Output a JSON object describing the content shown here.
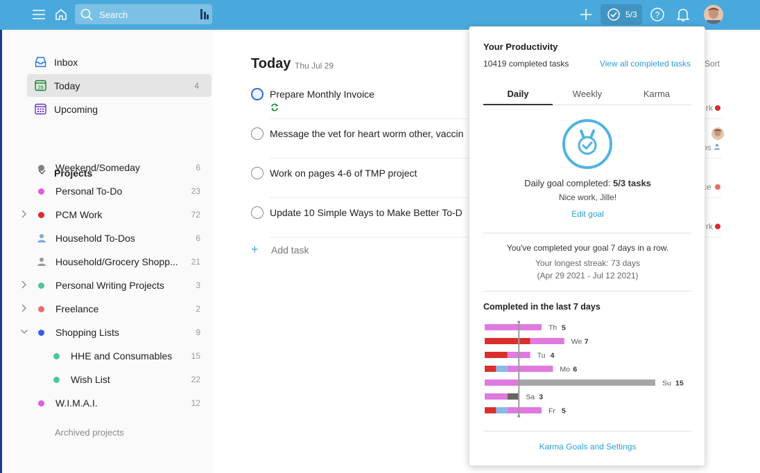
{
  "topbar": {
    "search_placeholder": "Search",
    "goal_progress": "5/3"
  },
  "sidebar": {
    "nav": [
      {
        "label": "Inbox",
        "count": ""
      },
      {
        "label": "Today",
        "count": "4"
      },
      {
        "label": "Upcoming",
        "count": ""
      }
    ],
    "projects_header": "Projects",
    "projects": [
      {
        "label": "Weekend/Someday",
        "count": "6",
        "color": "#808080"
      },
      {
        "label": "Personal To-Do",
        "count": "23",
        "color": "#e05ce0"
      },
      {
        "label": "PCM Work",
        "count": "72",
        "color": "#db2b2b"
      },
      {
        "label": "Household To-Dos",
        "count": "6",
        "color": "#7ba7e0"
      },
      {
        "label": "Household/Grocery Shopp...",
        "count": "21",
        "color": "#9a9a9a"
      },
      {
        "label": "Personal Writing Projects",
        "count": "3",
        "color": "#4cc4a0"
      },
      {
        "label": "Freelance",
        "count": "2",
        "color": "#f06a6a"
      },
      {
        "label": "Shopping Lists",
        "count": "9",
        "color": "#3b5ce6"
      },
      {
        "label": "HHE and Consumables",
        "count": "15",
        "color": "#4cc4a0"
      },
      {
        "label": "Wish List",
        "count": "22",
        "color": "#4cc4a0"
      },
      {
        "label": "W.I.M.A.I.",
        "count": "12",
        "color": "#e05ce0"
      }
    ],
    "archived": "Archived projects"
  },
  "main": {
    "title": "Today",
    "date": "Thu Jul 29",
    "sort": "Sort",
    "tasks": [
      {
        "text": "Prepare Monthly Invoice"
      },
      {
        "text": "Message the vet for heart worm other, vaccin"
      },
      {
        "text": "Work on pages 4-6 of TMP project"
      },
      {
        "text": "Update 10 Simple Ways to Make Better To-D"
      }
    ],
    "right_tags": [
      "rk",
      "os",
      "ce",
      "rk"
    ],
    "add_task": "Add task"
  },
  "popup": {
    "title": "Your Productivity",
    "completed": "10419 completed tasks",
    "view_all": "View all completed tasks",
    "tabs": [
      "Daily",
      "Weekly",
      "Karma"
    ],
    "goal_prefix": "Daily goal completed: ",
    "goal_value": "5/3 tasks",
    "nice": "Nice work, Jille!",
    "edit_goal": "Edit goal",
    "streak_line": "You've completed your goal 7 days in a row.",
    "longest": "Your longest streak: 73 days",
    "range": "(Apr 29 2021 - Jul 12 2021)",
    "last7_title": "Completed in the last 7 days",
    "karma_link": "Karma Goals and Settings"
  },
  "chart_data": {
    "type": "bar",
    "orientation": "horizontal-stacked",
    "categories": [
      "Th",
      "We",
      "Tu",
      "Mo",
      "Su",
      "Sa",
      "Fr"
    ],
    "totals": [
      5,
      7,
      4,
      6,
      15,
      3,
      5
    ],
    "goal": 3,
    "series_colors": {
      "red": "#d9302c",
      "blue": "#8ab8e8",
      "pink": "#e07ae0",
      "gray": "#a6a6a6",
      "dark": "#666666"
    },
    "segments": [
      [
        [
          "pink",
          5
        ]
      ],
      [
        [
          "red",
          4
        ],
        [
          "pink",
          3
        ]
      ],
      [
        [
          "red",
          2
        ],
        [
          "pink",
          2
        ]
      ],
      [
        [
          "red",
          1
        ],
        [
          "blue",
          1
        ],
        [
          "pink",
          4
        ]
      ],
      [
        [
          "pink",
          3
        ],
        [
          "gray",
          12
        ]
      ],
      [
        [
          "pink",
          2
        ],
        [
          "dark",
          1
        ]
      ],
      [
        [
          "red",
          1
        ],
        [
          "blue",
          1
        ],
        [
          "pink",
          3
        ]
      ]
    ]
  },
  "colors": {
    "topbar": "#4aa9dc",
    "accent": "#2a9fd6"
  }
}
